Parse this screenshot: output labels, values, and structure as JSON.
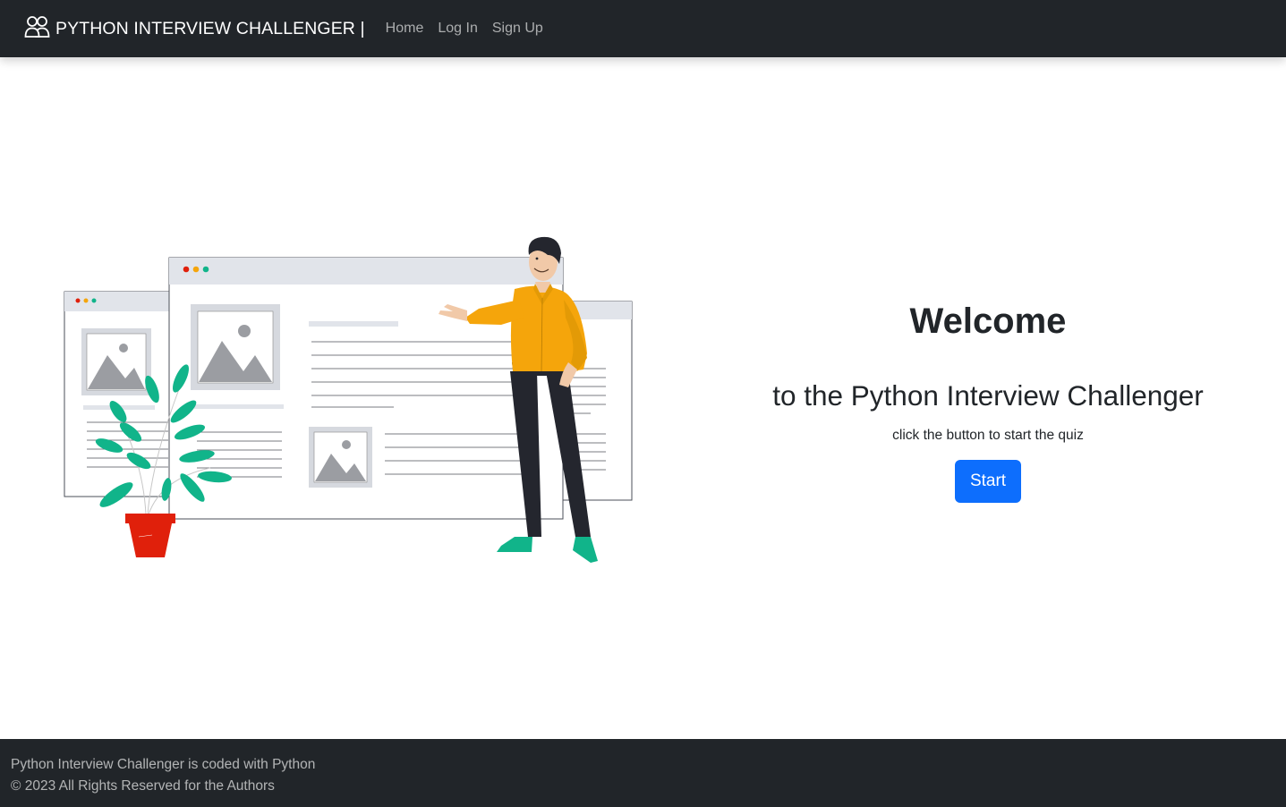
{
  "navbar": {
    "brand_text": "PYTHON INTERVIEW CHALLENGER |",
    "brand_icon": "people-icon",
    "links": [
      {
        "label": "Home"
      },
      {
        "label": "Log In"
      },
      {
        "label": "Sign Up"
      }
    ]
  },
  "hero": {
    "illustration": "presenter-pointing-at-web-pages",
    "title": "Welcome",
    "subtitle": "to the Python Interview Challenger",
    "hint": "click the button to start the quiz",
    "start_label": "Start"
  },
  "footer": {
    "line1": "Python Interview Challenger is coded with Python",
    "line2": "© 2023 All Rights Reserved for the Authors"
  },
  "colors": {
    "navbar_bg": "#212529",
    "primary": "#0d6efd",
    "shirt": "#f5a50b",
    "leaf": "#11b48a",
    "pot": "#e0200b"
  }
}
